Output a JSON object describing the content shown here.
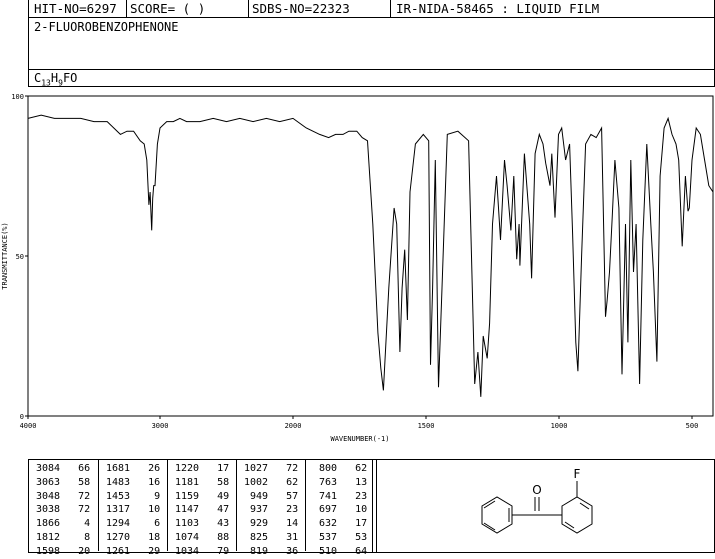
{
  "header": {
    "hit_no": "HIT-NO=6297",
    "score": "SCORE=  (  )",
    "sdbs_no": "SDBS-NO=22323",
    "ir_info": "IR-NIDA-58465 : LIQUID FILM"
  },
  "compound": {
    "name": "2-FLUOROBENZOPHENONE",
    "formula_c": "C",
    "formula_c_sub": "13",
    "formula_h": "H",
    "formula_h_sub": "9",
    "formula_rest": "FO"
  },
  "chart_data": {
    "type": "line",
    "xlabel": "WAVENUMBER(-1)",
    "ylabel": "TRANSMITTANCE(%)",
    "xlim": [
      4000,
      400
    ],
    "ylim": [
      0,
      100
    ],
    "x_ticks": [
      "4000",
      "3000",
      "2000",
      "1500",
      "1000",
      "500"
    ],
    "y_ticks": [
      "100",
      "50",
      "0"
    ],
    "series": [
      {
        "x": [
          4000,
          3900,
          3800,
          3700,
          3600,
          3500,
          3400,
          3350,
          3300,
          3250,
          3200,
          3150,
          3120,
          3100,
          3084,
          3075,
          3063,
          3055,
          3048,
          3038,
          3020,
          3000,
          2950,
          2900,
          2850,
          2800,
          2700,
          2600,
          2500,
          2400,
          2300,
          2200,
          2100,
          2000,
          1950,
          1900,
          1866,
          1840,
          1812,
          1790,
          1760,
          1740,
          1720,
          1700,
          1681,
          1670,
          1660,
          1640,
          1620,
          1610,
          1598,
          1590,
          1580,
          1570,
          1560,
          1540,
          1510,
          1490,
          1483,
          1475,
          1465,
          1453,
          1440,
          1420,
          1380,
          1340,
          1317,
          1305,
          1294,
          1285,
          1270,
          1261,
          1250,
          1235,
          1220,
          1205,
          1195,
          1181,
          1170,
          1159,
          1150,
          1147,
          1130,
          1110,
          1103,
          1090,
          1074,
          1060,
          1050,
          1034,
          1027,
          1015,
          1002,
          990,
          975,
          960,
          949,
          937,
          929,
          915,
          900,
          880,
          860,
          840,
          825,
          819,
          810,
          800,
          790,
          775,
          763,
          750,
          741,
          730,
          720,
          710,
          697,
          685,
          670,
          655,
          645,
          632,
          620,
          605,
          590,
          575,
          560,
          550,
          537,
          525,
          515,
          510,
          500,
          480,
          460,
          440,
          420,
          400
        ],
        "y": [
          93,
          94,
          93,
          93,
          93,
          92,
          92,
          90,
          88,
          89,
          89,
          86,
          85,
          80,
          66,
          70,
          58,
          68,
          72,
          72,
          85,
          90,
          92,
          92,
          93,
          92,
          92,
          93,
          92,
          93,
          92,
          93,
          92,
          93,
          90,
          88,
          87,
          88,
          88,
          89,
          89,
          87,
          86,
          60,
          26,
          15,
          8,
          40,
          65,
          60,
          20,
          40,
          52,
          30,
          70,
          85,
          88,
          86,
          16,
          40,
          80,
          9,
          40,
          88,
          89,
          86,
          10,
          20,
          6,
          25,
          18,
          29,
          60,
          75,
          55,
          80,
          72,
          58,
          75,
          49,
          60,
          47,
          82,
          60,
          43,
          82,
          88,
          85,
          79,
          72,
          82,
          62,
          88,
          90,
          80,
          85,
          57,
          23,
          14,
          50,
          85,
          88,
          87,
          90,
          31,
          36,
          45,
          62,
          80,
          65,
          13,
          60,
          23,
          80,
          45,
          60,
          10,
          55,
          85,
          60,
          45,
          17,
          75,
          90,
          93,
          88,
          85,
          80,
          53,
          75,
          64,
          65,
          80,
          90,
          88,
          80,
          72,
          70
        ]
      }
    ]
  },
  "peak_table": {
    "columns": [
      [
        [
          "3084",
          "66"
        ],
        [
          "3063",
          "58"
        ],
        [
          "3048",
          "72"
        ],
        [
          "3038",
          "72"
        ],
        [
          "1866",
          "4"
        ],
        [
          "1812",
          "8"
        ],
        [
          "1598",
          "20"
        ]
      ],
      [
        [
          "1681",
          "26"
        ],
        [
          "1483",
          "16"
        ],
        [
          "1453",
          "9"
        ],
        [
          "1317",
          "10"
        ],
        [
          "1294",
          "6"
        ],
        [
          "1270",
          "18"
        ],
        [
          "1261",
          "29"
        ]
      ],
      [
        [
          "1220",
          "17"
        ],
        [
          "1181",
          "58"
        ],
        [
          "1159",
          "49"
        ],
        [
          "1147",
          "47"
        ],
        [
          "1103",
          "43"
        ],
        [
          "1074",
          "88"
        ],
        [
          "1034",
          "79"
        ]
      ],
      [
        [
          "1027",
          "72"
        ],
        [
          "1002",
          "62"
        ],
        [
          "949",
          "57"
        ],
        [
          "937",
          "23"
        ],
        [
          "929",
          "14"
        ],
        [
          "825",
          "31"
        ],
        [
          "819",
          "36"
        ]
      ],
      [
        [
          "800",
          "62"
        ],
        [
          "763",
          "13"
        ],
        [
          "741",
          "23"
        ],
        [
          "697",
          "10"
        ],
        [
          "632",
          "17"
        ],
        [
          "537",
          "53"
        ],
        [
          "510",
          "64"
        ]
      ]
    ]
  },
  "structure": {
    "substituent_label": "F",
    "carbonyl_label": "O"
  }
}
